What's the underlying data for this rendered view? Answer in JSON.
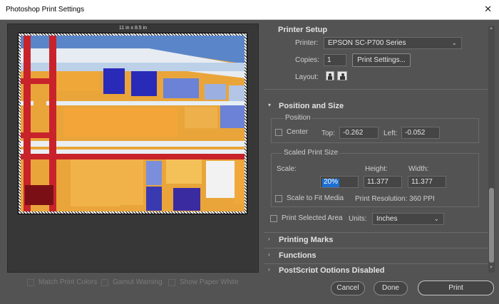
{
  "window": {
    "title": "Photoshop Print Settings",
    "close_glyph": "✕"
  },
  "preview": {
    "paper_size": "11 in x 8.5 in"
  },
  "checkboxes": {
    "match_print_colors": "Match Print Colors",
    "gamut_warning": "Gamut Warning",
    "show_paper_white": "Show Paper White"
  },
  "printer_setup": {
    "title": "Printer Setup",
    "printer_label": "Printer:",
    "printer_value": "EPSON SC-P700 Series",
    "copies_label": "Copies:",
    "copies_value": "1",
    "print_settings_button": "Print Settings...",
    "layout_label": "Layout:"
  },
  "position_size": {
    "title": "Position and Size",
    "position_group": "Position",
    "center_label": "Center",
    "top_label": "Top:",
    "top_value": "-0.262",
    "left_label": "Left:",
    "left_value": "-0.052",
    "scaled_group": "Scaled Print Size",
    "scale_label": "Scale:",
    "scale_value": "20%",
    "height_label": "Height:",
    "height_value": "11.377",
    "width_label": "Width:",
    "width_value": "11.377",
    "scale_to_fit_label": "Scale to Fit Media",
    "print_resolution": "Print Resolution: 360 PPI",
    "print_selected_area_label": "Print Selected Area",
    "units_label": "Units:",
    "units_value": "Inches"
  },
  "collapsed_sections": {
    "printing_marks": "Printing Marks",
    "functions": "Functions",
    "postscript": "PostScript Options Disabled"
  },
  "footer": {
    "cancel": "Cancel",
    "done": "Done",
    "print": "Print"
  },
  "icons": {
    "expanded": "▾",
    "collapsed": "›",
    "dropdown": "⌄"
  }
}
